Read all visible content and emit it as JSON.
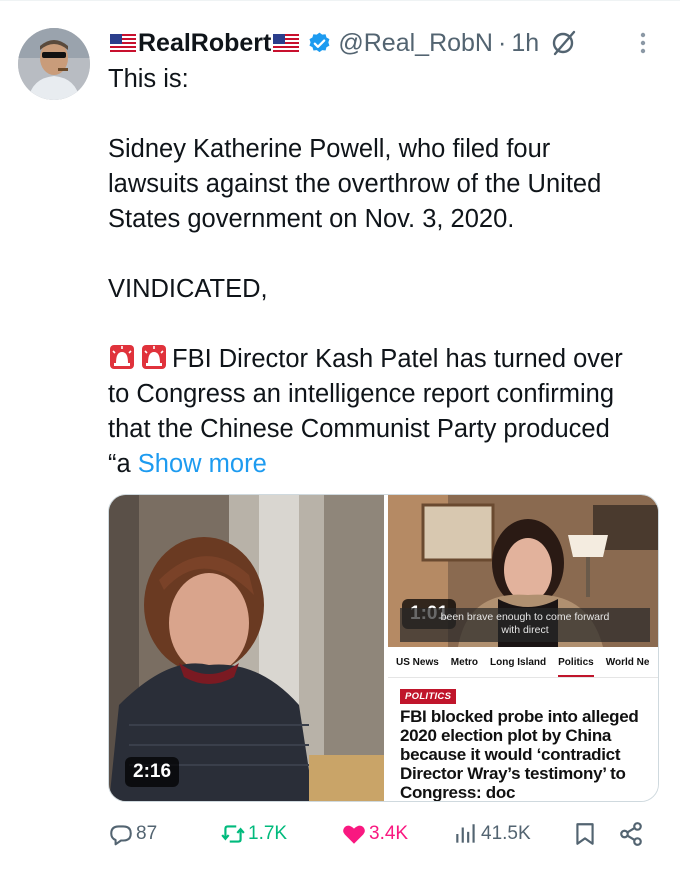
{
  "post": {
    "display_name": "RealRobert",
    "handle": "@Real_RobN",
    "separator": "·",
    "time": "1h",
    "text": {
      "line1": "This is:",
      "para1": [
        "Sidney Katherine Powell, who filed four",
        "lawsuits against the overthrow of the United",
        "States government on Nov. 3, 2020."
      ],
      "para2": "VINDICATED,",
      "para3": [
        "FBI Director Kash Patel has turned over",
        "to Congress an intelligence report confirming",
        "that the Chinese Communist Party produced",
        "“a"
      ],
      "show_more": "Show more"
    },
    "icons": {
      "flag": "us-flag-icon",
      "verified": "verified-badge-icon",
      "grok": "grok-icon",
      "more": "more-options-icon",
      "siren": "siren-emoji-icon"
    },
    "colors": {
      "link": "#1d9bf0",
      "verified": "#1d9bf0",
      "retweet": "#00ba7c",
      "like": "#f91880",
      "secondary_text": "#536471"
    }
  },
  "media": {
    "video_left": {
      "duration": "2:16"
    },
    "video_right": {
      "duration": "1:01",
      "caption_line1": "been brave enough to come forward",
      "caption_line2": "with direct"
    },
    "article": {
      "nav": [
        "US News",
        "Metro",
        "Long Island",
        "Politics",
        "World Ne"
      ],
      "active_nav": "Politics",
      "badge": "POLITICS",
      "headline": "FBI blocked probe into alleged 2020 election plot by China because it would ‘contradict Director Wray’s testimony’ to Congress: doc"
    }
  },
  "actions": {
    "replies": "87",
    "reposts": "1.7K",
    "likes": "3.4K",
    "views": "41.5K"
  }
}
